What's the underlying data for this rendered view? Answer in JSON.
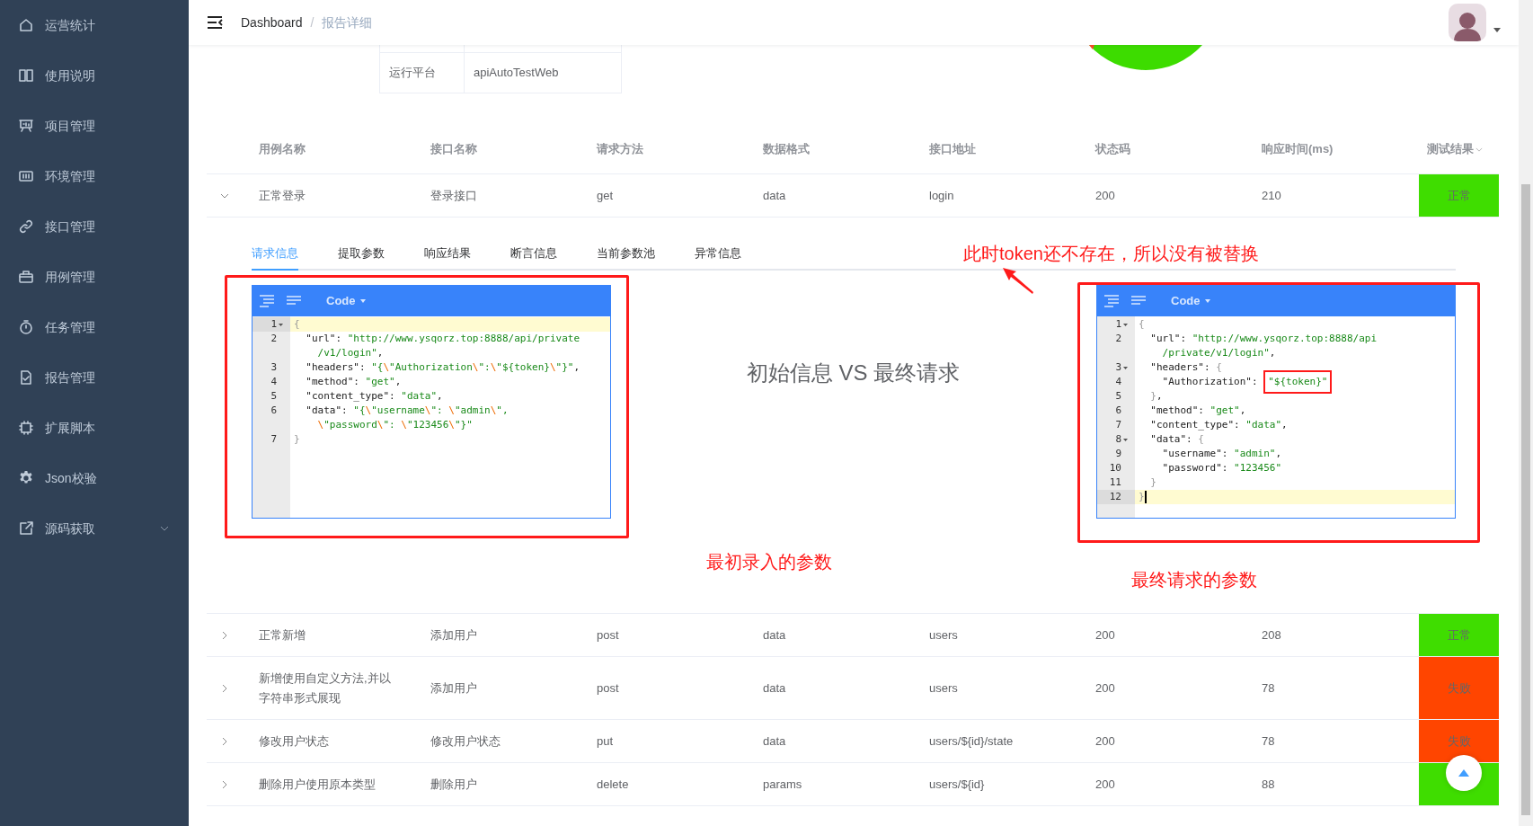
{
  "sidebar": {
    "items": [
      {
        "label": "运营统计",
        "kind": "link"
      },
      {
        "label": "使用说明",
        "kind": "link"
      },
      {
        "label": "项目管理",
        "kind": "link"
      },
      {
        "label": "环境管理",
        "kind": "link"
      },
      {
        "label": "接口管理",
        "kind": "link"
      },
      {
        "label": "用例管理",
        "kind": "link"
      },
      {
        "label": "任务管理",
        "kind": "link"
      },
      {
        "label": "报告管理",
        "kind": "link"
      },
      {
        "label": "扩展脚本",
        "kind": "link"
      },
      {
        "label": "Json校验",
        "kind": "link"
      },
      {
        "label": "源码获取",
        "kind": "submenu"
      }
    ]
  },
  "header": {
    "breadcrumb": [
      {
        "label": "Dashboard",
        "current": false
      },
      {
        "label": "报告详细",
        "current": true
      }
    ],
    "separator": "/"
  },
  "info_table": {
    "rows": [
      {
        "label": "运行平台",
        "value": "apiAutoTestWeb"
      }
    ]
  },
  "results_table": {
    "columns": [
      "用例名称",
      "接口名称",
      "请求方法",
      "数据格式",
      "接口地址",
      "状态码",
      "响应时间(ms)",
      "测试结果"
    ],
    "rows": [
      {
        "expanded": true,
        "cells": [
          "正常登录",
          "登录接口",
          "get",
          "data",
          "login",
          "200",
          "210"
        ],
        "result": "正常",
        "color": "#3fdd00"
      },
      {
        "expanded": false,
        "cells": [
          "正常新增",
          "添加用户",
          "post",
          "data",
          "users",
          "200",
          "208"
        ],
        "result": "正常",
        "color": "#3fdd00"
      },
      {
        "expanded": false,
        "cells": [
          "新增使用自定义方法,并以字符串形式展现",
          "添加用户",
          "post",
          "data",
          "users",
          "200",
          "78"
        ],
        "result": "失败",
        "color": "#ff4500"
      },
      {
        "expanded": false,
        "cells": [
          "修改用户状态",
          "修改用户状态",
          "put",
          "data",
          "users/${id}/state",
          "200",
          "78"
        ],
        "result": "失败",
        "color": "#ff4500"
      },
      {
        "expanded": false,
        "cells": [
          "删除用户使用原本类型",
          "删除用户",
          "delete",
          "params",
          "users/${id}",
          "200",
          "88"
        ],
        "color": "#3fdd00"
      }
    ]
  },
  "detail": {
    "tabs": [
      {
        "label": "请求信息",
        "selected": true
      },
      {
        "label": "提取参数",
        "selected": false
      },
      {
        "label": "响应结果",
        "selected": false
      },
      {
        "label": "断言信息",
        "selected": false
      },
      {
        "label": "当前参数池",
        "selected": false
      },
      {
        "label": "异常信息",
        "selected": false
      }
    ],
    "note": "此时token还不存在，所以没有被替换",
    "comparison_title": "初始信息 VS 最终请求",
    "editors": [
      {
        "mode": "Code",
        "caption": "最初录入的参数",
        "lines": [
          {
            "number": "1",
            "text": "{",
            "foldable": true,
            "active": true,
            "cursor": false
          },
          {
            "number": "2",
            "text": "  \"url\": \"http://www.ysqorz.top:8888/api/private",
            "foldable": false,
            "active": false,
            "cursor": false
          },
          {
            "text": "    /v1/login\",",
            "foldable": false,
            "active": false,
            "cursor": false
          },
          {
            "number": "3",
            "text": "  \"headers\": \"{\\\"Authorization\\\":\\\"${token}\\\"}\",",
            "foldable": false,
            "active": false,
            "cursor": false
          },
          {
            "number": "4",
            "text": "  \"method\": \"get\",",
            "foldable": false,
            "active": false,
            "cursor": false
          },
          {
            "number": "5",
            "text": "  \"content_type\": \"data\",",
            "foldable": false,
            "active": false,
            "cursor": false
          },
          {
            "number": "6",
            "text": "  \"data\": \"{\\\"username\\\": \\\"admin\\\",",
            "foldable": false,
            "active": false,
            "cursor": false
          },
          {
            "text": "    \\\"password\\\": \\\"123456\\\"}\"",
            "foldable": false,
            "active": false,
            "cursor": false
          },
          {
            "number": "7",
            "text": "}",
            "foldable": false,
            "active": false,
            "cursor": false
          }
        ]
      },
      {
        "mode": "Code",
        "caption": "最终请求的参数",
        "lines": [
          {
            "number": "1",
            "text": "{",
            "foldable": true,
            "active": false,
            "cursor": false
          },
          {
            "number": "2",
            "text": "  \"url\": \"http://www.ysqorz.top:8888/api",
            "foldable": false,
            "active": false,
            "cursor": false
          },
          {
            "text": "    /private/v1/login\",",
            "foldable": false,
            "active": false,
            "cursor": false
          },
          {
            "number": "3",
            "text": "  \"headers\": {",
            "foldable": true,
            "active": false,
            "cursor": false
          },
          {
            "number": "4",
            "text": "    \"Authorization\": ",
            "boxed": "\"${token}\"",
            "foldable": false,
            "active": false,
            "cursor": false
          },
          {
            "number": "5",
            "text": "  },",
            "foldable": false,
            "active": false,
            "cursor": false
          },
          {
            "number": "6",
            "text": "  \"method\": \"get\",",
            "foldable": false,
            "active": false,
            "cursor": false
          },
          {
            "number": "7",
            "text": "  \"content_type\": \"data\",",
            "foldable": false,
            "active": false,
            "cursor": false
          },
          {
            "number": "8",
            "text": "  \"data\": {",
            "foldable": true,
            "active": false,
            "cursor": false
          },
          {
            "number": "9",
            "text": "    \"username\": \"admin\",",
            "foldable": false,
            "active": false,
            "cursor": false
          },
          {
            "number": "10",
            "text": "    \"password\": \"123456\"",
            "foldable": false,
            "active": false,
            "cursor": false
          },
          {
            "number": "11",
            "text": "  }",
            "foldable": false,
            "active": false,
            "cursor": false
          },
          {
            "number": "12",
            "text": "}",
            "foldable": false,
            "active": true,
            "cursor": true
          }
        ]
      }
    ]
  }
}
